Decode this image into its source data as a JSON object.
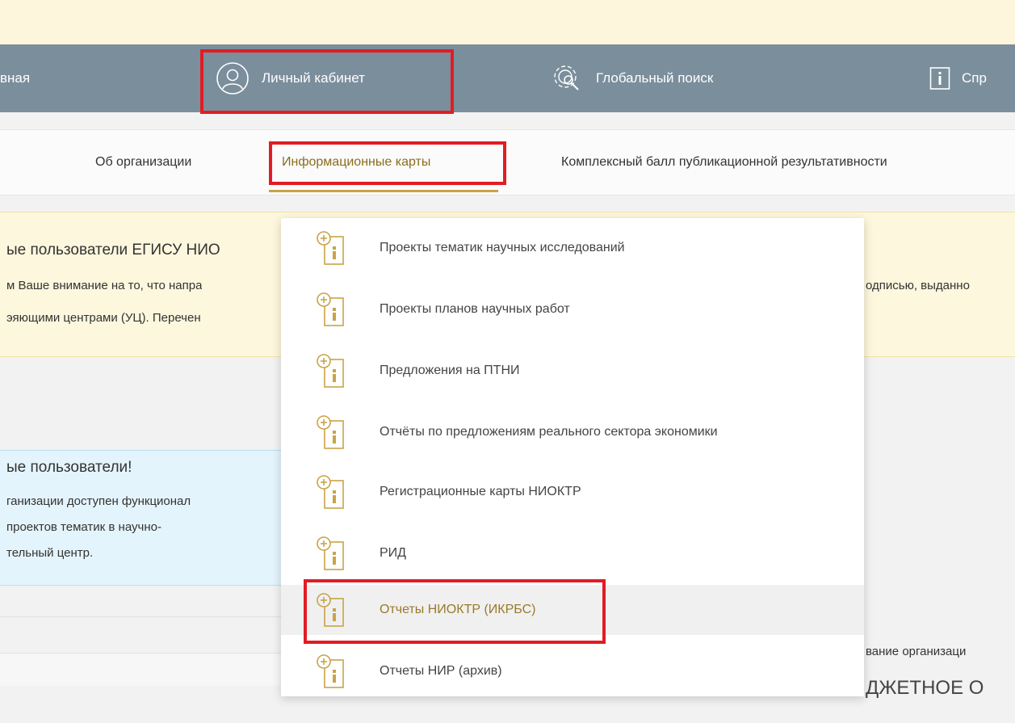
{
  "nav": {
    "home_partial": "вная",
    "cabinet": "Личный кабинет",
    "search": "Глобальный поиск",
    "help_partial": "Спр"
  },
  "tabs": {
    "about": "Об организации",
    "info_cards": "Информационные карты",
    "complex_score": "Комплексный балл публикационной результативности"
  },
  "notice_yellow": {
    "title_partial": "ые пользователи ЕГИСУ НИО",
    "line1_left": "м Ваше внимание на то, что напра",
    "line1_right": "одписью, выданно",
    "line2_left": "эяющими центрами (УЦ). Перечен"
  },
  "notice_blue": {
    "title_partial": "ые пользователи!",
    "line1": "ганизации доступен функционал",
    "line2": "проектов тематик в научно-",
    "line3": "тельный центр."
  },
  "background_right": {
    "line1_partial": "вание организаци",
    "line2_partial": "ДЖЕТНОЕ О"
  },
  "dropdown": {
    "items": [
      {
        "label": "Проекты тематик научных исследований"
      },
      {
        "label": "Проекты планов научных работ"
      },
      {
        "label": "Предложения на ПТНИ"
      },
      {
        "label": "Отчёты по предложениям реального сектора экономики"
      },
      {
        "label": "Регистрационные карты НИОКТР"
      },
      {
        "label": "РИД"
      },
      {
        "label": "Отчеты НИОКТР (ИКРБС)"
      },
      {
        "label": "Отчеты НИР (архив)"
      }
    ]
  },
  "colors": {
    "nav_bg": "#7b8e9c",
    "accent_gold": "#c9a347",
    "highlight_red": "#e21c24"
  }
}
